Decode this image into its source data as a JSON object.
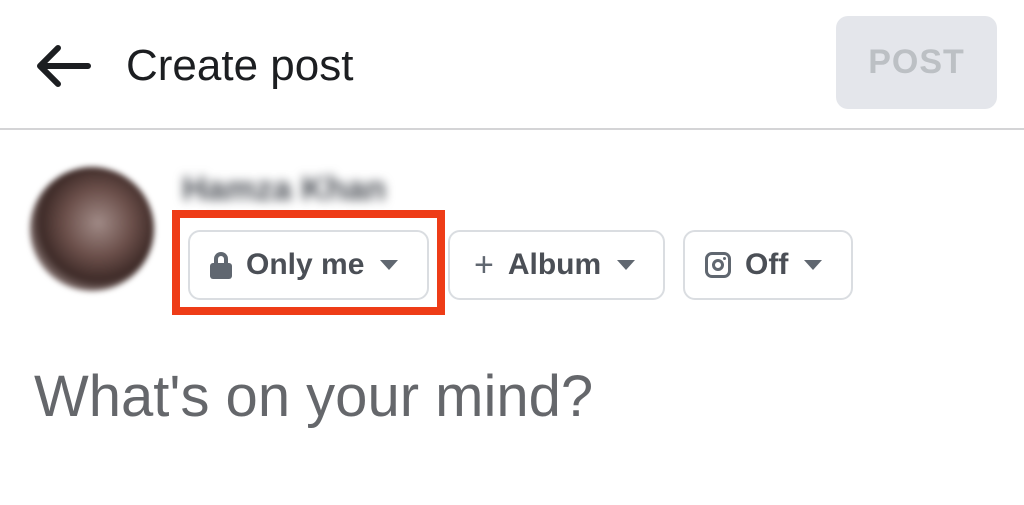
{
  "header": {
    "title": "Create post",
    "post_label": "POST"
  },
  "user": {
    "name": "Hamza Khan"
  },
  "chips": {
    "privacy_label": "Only me",
    "album_label": "Album",
    "instagram_label": "Off"
  },
  "composer": {
    "placeholder": "What's on your mind?"
  },
  "colors": {
    "highlight": "#ee3c17",
    "post_button_bg": "#e4e6eb",
    "post_button_text": "#bcc0c4"
  },
  "icons": {
    "back": "arrow-left-icon",
    "privacy": "lock-icon",
    "album": "plus-icon",
    "instagram": "instagram-icon"
  }
}
